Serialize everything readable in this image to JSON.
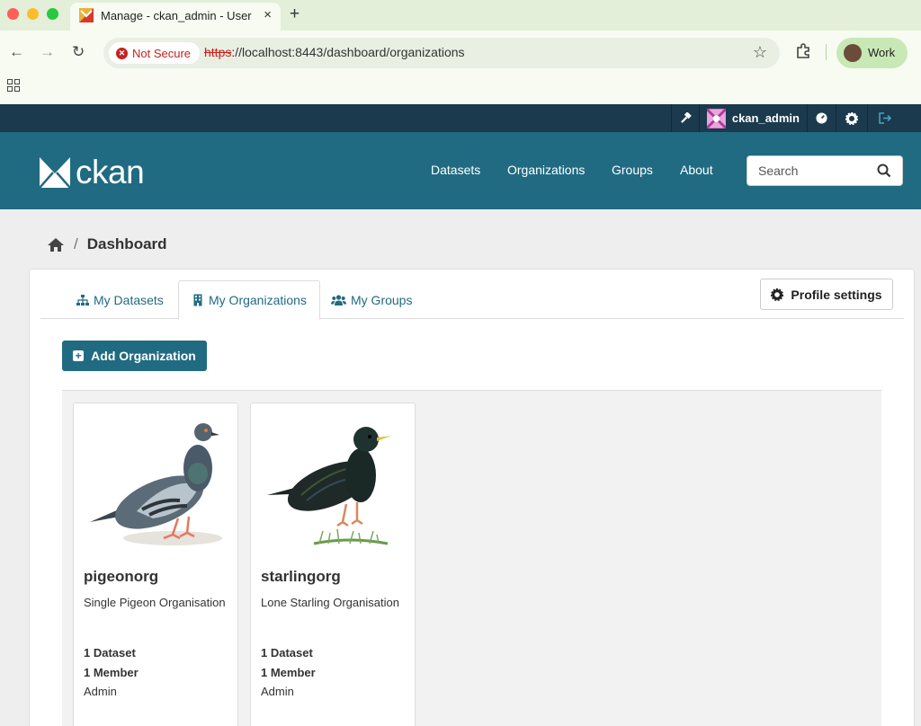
{
  "browser": {
    "tab_title": "Manage - ckan_admin - User",
    "tab_close": "×",
    "new_tab": "+",
    "security_label": "Not Secure",
    "url_scheme": "https",
    "url_rest": "://localhost:8443/dashboard/organizations",
    "profile_label": "Work",
    "nav_back": "←",
    "nav_forward": "→",
    "nav_reload": "↻",
    "bookmark_star": "☆"
  },
  "account": {
    "username": "ckan_admin"
  },
  "masthead": {
    "logo_text": "ckan",
    "nav": [
      "Datasets",
      "Organizations",
      "Groups",
      "About"
    ],
    "search_placeholder": "Search"
  },
  "breadcrumb": {
    "separator": "/",
    "current": "Dashboard"
  },
  "tabs": [
    {
      "label": "My Datasets",
      "active": false
    },
    {
      "label": "My Organizations",
      "active": true
    },
    {
      "label": "My Groups",
      "active": false
    }
  ],
  "profile_settings_label": "Profile settings",
  "add_organization_label": "Add Organization",
  "organizations": [
    {
      "name": "pigeonorg",
      "description": "Single Pigeon Organisation",
      "datasets": "1 Dataset",
      "members": "1 Member",
      "role": "Admin"
    },
    {
      "name": "starlingorg",
      "description": "Lone Starling Organisation",
      "datasets": "1 Dataset",
      "members": "1 Member",
      "role": "Admin"
    }
  ],
  "colors": {
    "ckan_primary": "#206b82",
    "account_bar": "#1c3a4d",
    "browser_frame": "#e3efd9"
  }
}
